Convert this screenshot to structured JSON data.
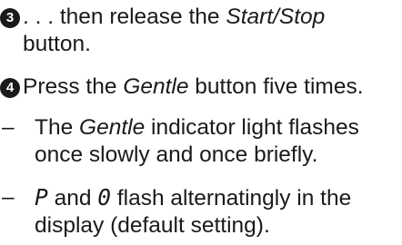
{
  "steps": [
    {
      "number": "3",
      "lines": [
        ". . . then release the ",
        "Start/Stop",
        "button."
      ]
    },
    {
      "number": "4",
      "lines": [
        "Press the ",
        "Gentle",
        " button five times."
      ]
    }
  ],
  "bullets": [
    {
      "dash": "–",
      "line1_a": "The ",
      "line1_em": "Gentle",
      "line1_b": " indicator light flashes",
      "line2": "once  slowly and once briefly."
    },
    {
      "dash": "–",
      "sym1": "P",
      "mid": " and ",
      "sym2": "0",
      "line1_rest": " flash alternatingly in the",
      "line2": "display (default setting)."
    }
  ]
}
